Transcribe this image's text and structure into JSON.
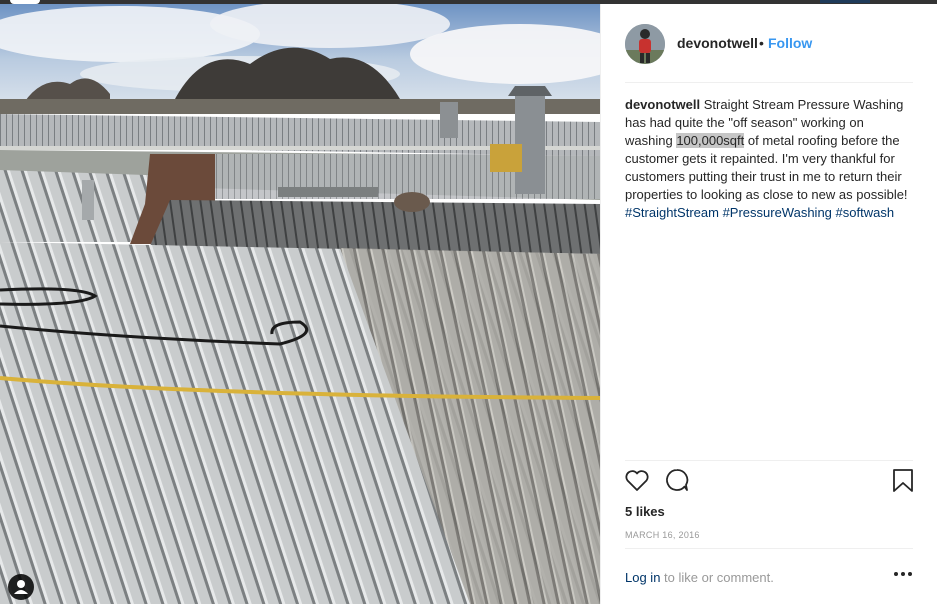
{
  "post": {
    "username": "devonotwell",
    "separator": "•",
    "follow_label": "Follow",
    "caption": {
      "username": "devonotwell",
      "text_before": " Straight Stream Pressure Washing has had quite the \"off season\" working on washing ",
      "highlight": "100,000sqft",
      "text_after": " of metal roofing before the customer gets it repainted. I'm very thankful for customers putting their trust in me to return their properties to looking as close to new as possible! ",
      "hashtags": [
        "#StraightStream",
        "#PressureWashing",
        "#softwash"
      ]
    },
    "likes": "5 likes",
    "date": "MARCH 16, 2016",
    "footer": {
      "login_label": "Log in",
      "prompt": " to like or comment."
    }
  },
  "icons": {
    "like": "heart-icon",
    "comment": "comment-icon",
    "save": "bookmark-icon",
    "more": "more-options-icon",
    "tagged": "user-tag-icon"
  },
  "colors": {
    "follow": "#3897f0",
    "hashtag": "#003569",
    "muted": "#999999"
  }
}
